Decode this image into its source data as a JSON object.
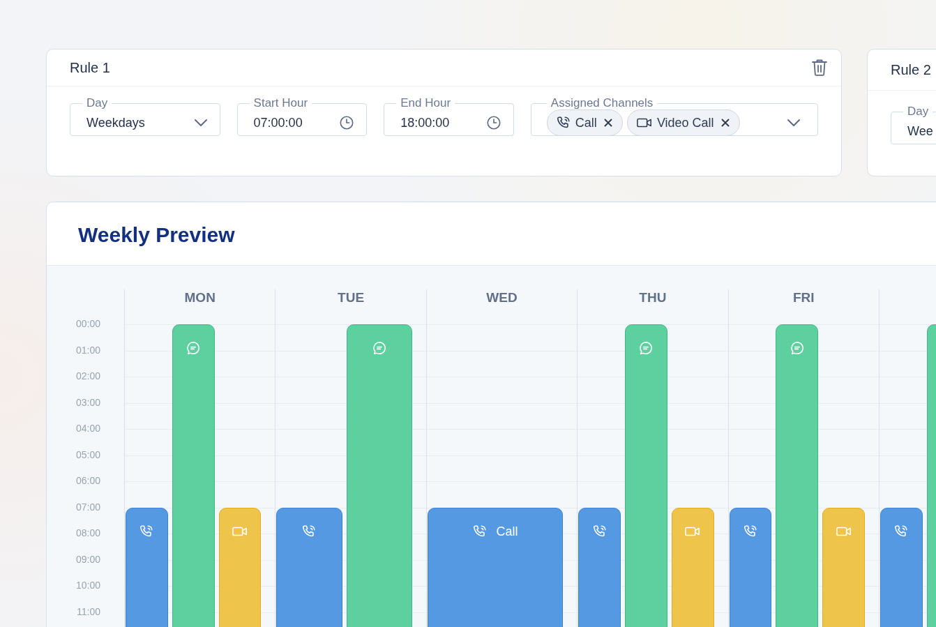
{
  "rules": [
    {
      "title": "Rule 1",
      "deletable": true,
      "fields": [
        {
          "kind": "select",
          "label": "Day",
          "value": "Weekdays"
        },
        {
          "kind": "time",
          "label": "Start Hour",
          "value": "07:00:00"
        },
        {
          "kind": "time",
          "label": "End Hour",
          "value": "18:00:00"
        },
        {
          "kind": "chips",
          "label": "Assigned Channels",
          "chips": [
            {
              "kind": "call",
              "label": "Call"
            },
            {
              "kind": "video",
              "label": "Video Call"
            }
          ]
        }
      ]
    },
    {
      "title": "Rule 2",
      "fields": [
        {
          "kind": "select",
          "label": "Day",
          "value": "Wee"
        }
      ]
    }
  ],
  "preview": {
    "title": "Weekly Preview",
    "hours": [
      "00:00",
      "01:00",
      "02:00",
      "03:00",
      "04:00",
      "05:00",
      "06:00",
      "07:00",
      "08:00",
      "09:00",
      "10:00",
      "11:00"
    ],
    "days": [
      {
        "label": "MON",
        "blocks": [
          {
            "kind": "call",
            "all_day": false
          },
          {
            "kind": "chat",
            "all_day": true
          },
          {
            "kind": "video",
            "all_day": false
          }
        ]
      },
      {
        "label": "TUE",
        "blocks": [
          {
            "kind": "call",
            "all_day": false
          },
          {
            "kind": "chat",
            "all_day": true
          }
        ]
      },
      {
        "label": "WED",
        "blocks": [
          {
            "kind": "call",
            "all_day": false,
            "label": "Call"
          }
        ]
      },
      {
        "label": "THU",
        "blocks": [
          {
            "kind": "call",
            "all_day": false
          },
          {
            "kind": "chat",
            "all_day": true
          },
          {
            "kind": "video",
            "all_day": false
          }
        ]
      },
      {
        "label": "FRI",
        "blocks": [
          {
            "kind": "call",
            "all_day": false
          },
          {
            "kind": "chat",
            "all_day": true
          },
          {
            "kind": "video",
            "all_day": false
          }
        ]
      },
      {
        "clipped": true,
        "blocks": [
          {
            "kind": "call",
            "all_day": false
          },
          {
            "kind": "chat",
            "all_day": true
          }
        ]
      }
    ]
  }
}
